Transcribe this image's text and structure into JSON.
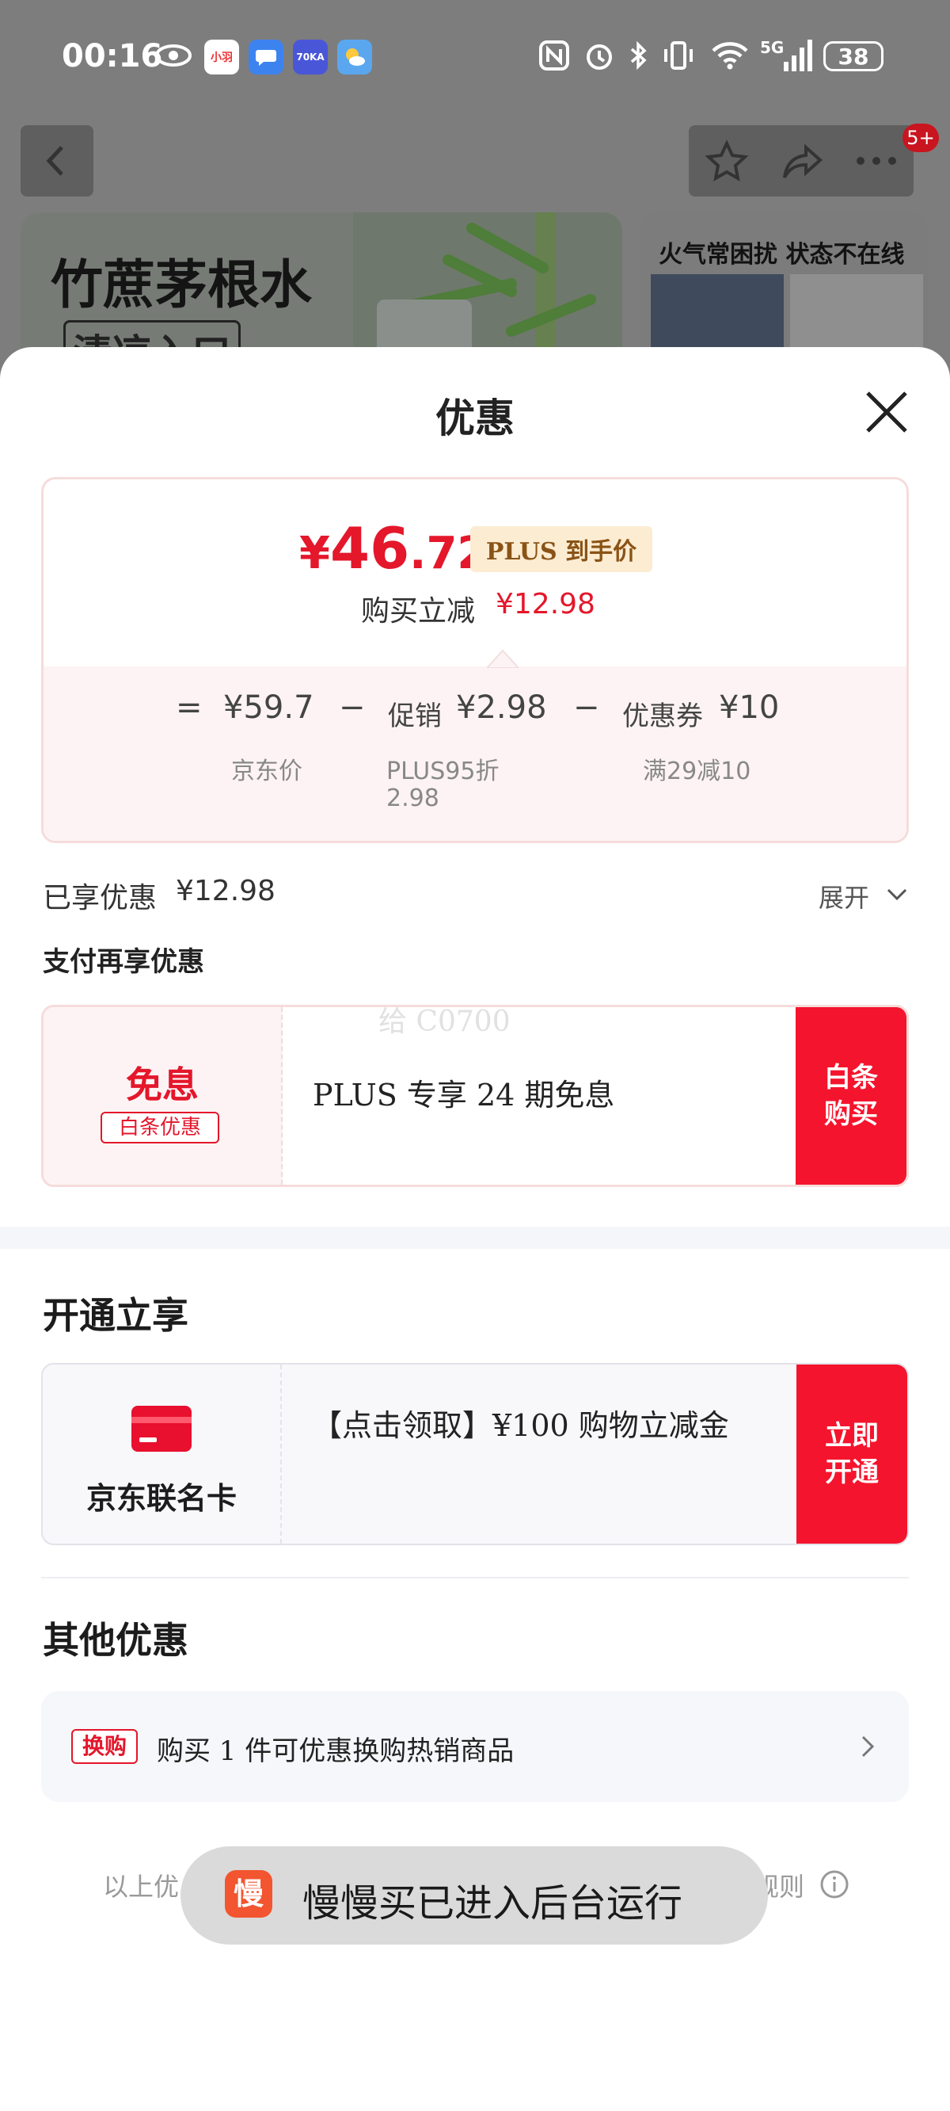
{
  "status_bar": {
    "time": "00:16",
    "notification_apps": [
      "eye-icon",
      "xiaozhu-app",
      "messages-app",
      "70ka-app",
      "weather-app"
    ],
    "xiaozhu_label": "小羽",
    "app70_label": "70KA",
    "network": "5G",
    "battery": "38"
  },
  "background_page": {
    "badge": "5+",
    "banner_title": "竹蔗茅根水",
    "banner_tag": "清凉入口",
    "side_banner_title": "火气常困扰 状态不在线"
  },
  "sheet": {
    "title": "优惠",
    "price_card": {
      "currency": "¥",
      "price_int": "46",
      "price_dec": ".72",
      "plus_tag": "PLUS 到手价",
      "buy_discount_label": "购买立减",
      "buy_discount_value": "¥12.98",
      "eq": "=",
      "minus": "−",
      "jd_price": "¥59.7",
      "jd_price_label": "京东价",
      "promo_label": "促销",
      "promo_value": "¥2.98",
      "promo_note_1": "PLUS95折",
      "promo_note_2": "2.98",
      "coupon_label": "优惠券",
      "coupon_value": "¥10",
      "coupon_note": "满29减10"
    },
    "enjoyed_label": "已享优惠",
    "enjoyed_value": "¥12.98",
    "expand_label": "展开",
    "pay_section_label": "支付再享优惠",
    "watermark": "给 C0700",
    "pay_card": {
      "tag_title": "免息",
      "tag_sub": "白条优惠",
      "desc": "PLUS 专享 24 期免息",
      "button": "白条\n购买"
    },
    "open_section_title": "开通立享",
    "cobrand_card": {
      "name": "京东联名卡",
      "desc": "【点击领取】¥100 购物立减金",
      "button": "立即\n开通"
    },
    "other_section_title": "其他优惠",
    "other_item": {
      "tag": "换购",
      "text": "购买 1 件可优惠换购热销商品"
    },
    "footer_left": "以上优",
    "footer_right": "看规则"
  },
  "toast": {
    "app_icon_text": "慢",
    "message": "慢慢买已进入后台运行"
  },
  "colors": {
    "accent_red": "#e4172b",
    "button_red": "#f5142d",
    "plus_gold": "#8a5316"
  }
}
